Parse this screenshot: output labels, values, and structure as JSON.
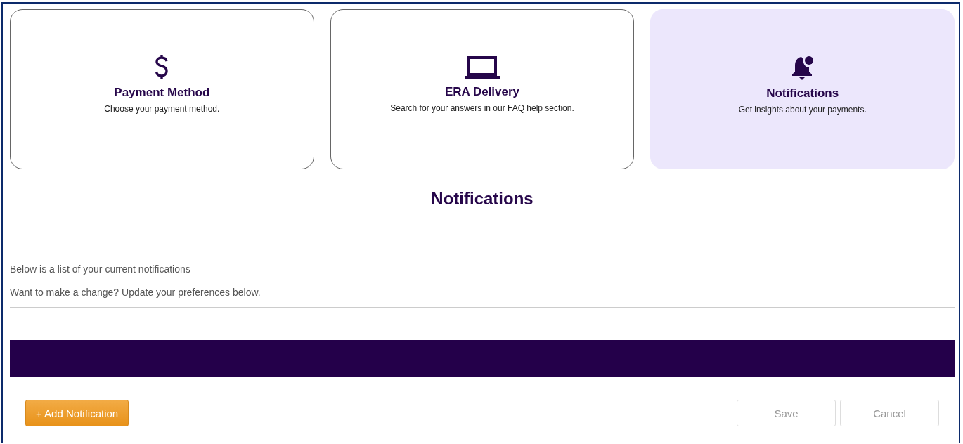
{
  "cards": [
    {
      "kind": "dollar",
      "title": "Payment Method",
      "description": "Choose your payment method.",
      "selected": false
    },
    {
      "kind": "laptop",
      "title": "ERA Delivery",
      "description": "Search for your answers in our FAQ help section.",
      "selected": false
    },
    {
      "kind": "bell",
      "title": "Notifications",
      "description": "Get insights about your payments.",
      "selected": true
    }
  ],
  "heading": "Notifications",
  "intro": [
    "Below is a list of your current notifications",
    "Want to make a change? Update your preferences below."
  ],
  "add_button": {
    "label": "+ Add Notification"
  },
  "actions": [
    {
      "label": "Save",
      "disabled": true
    },
    {
      "label": "Cancel",
      "disabled": true
    }
  ]
}
